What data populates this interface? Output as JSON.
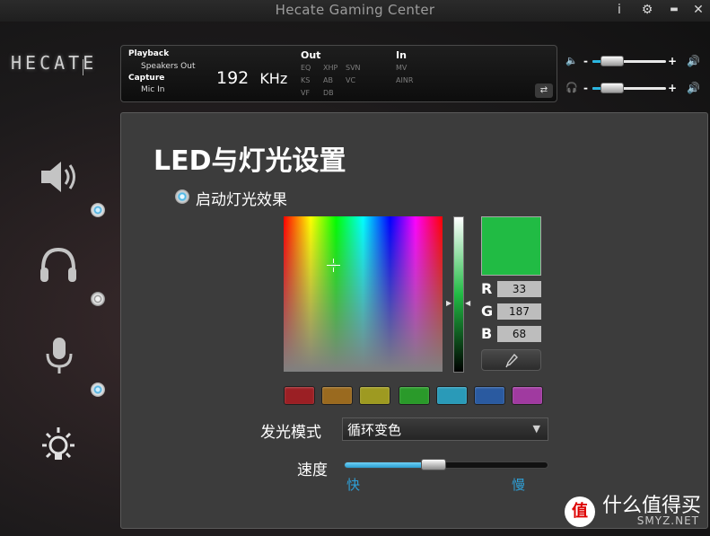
{
  "window": {
    "title": "Hecate Gaming Center",
    "logo": "HECATE",
    "buttons": {
      "info": "i",
      "settings": "⚙",
      "minimize": "▬",
      "close": "✕"
    }
  },
  "status": {
    "playback_label": "Playback",
    "playback_device": "Speakers Out",
    "capture_label": "Capture",
    "capture_device": "Mic In",
    "sample_rate": "192",
    "sample_unit": "KHz",
    "out_title": "Out",
    "out_tags": [
      "EQ",
      "XHP",
      "SVN",
      "KS",
      "AB",
      "VC",
      "VF",
      "DB"
    ],
    "in_title": "In",
    "in_tags": [
      "MV",
      "AINR"
    ]
  },
  "volume": {
    "speaker": {
      "level": 0.27,
      "minus": "-",
      "plus": "+"
    },
    "headphone": {
      "level": 0.27,
      "minus": "-",
      "plus": "+"
    }
  },
  "sidebar": {
    "items": [
      {
        "name": "speaker",
        "icon": "speaker-icon",
        "active": true
      },
      {
        "name": "headphone",
        "icon": "headphone-icon",
        "active": false
      },
      {
        "name": "microphone",
        "icon": "microphone-icon",
        "active": true
      },
      {
        "name": "lighting",
        "icon": "lightbulb-icon",
        "active": false
      }
    ]
  },
  "led": {
    "title": "LED与灯光设置",
    "enable_label": "启动灯光效果",
    "enabled": true,
    "picker": {
      "hue": 0.31,
      "saturation_y": 0.31
    },
    "color": {
      "hex": "#21BB44",
      "r": "33",
      "g": "187",
      "b": "68"
    },
    "rgb_letters": {
      "r": "R",
      "g": "G",
      "b": "B"
    },
    "presets": [
      "#9b1f24",
      "#9a6a1f",
      "#9e9a21",
      "#2a9a2a",
      "#2a9ab8",
      "#2a5aa0",
      "#a03aa0"
    ],
    "mode_label": "发光模式",
    "mode_value": "循环变色",
    "speed_label": "速度",
    "speed_value": 0.44,
    "speed_min": "快",
    "speed_max": "慢"
  },
  "watermark": {
    "logo": "值",
    "text": "什么值得买",
    "sub": "SMYZ.NET"
  }
}
